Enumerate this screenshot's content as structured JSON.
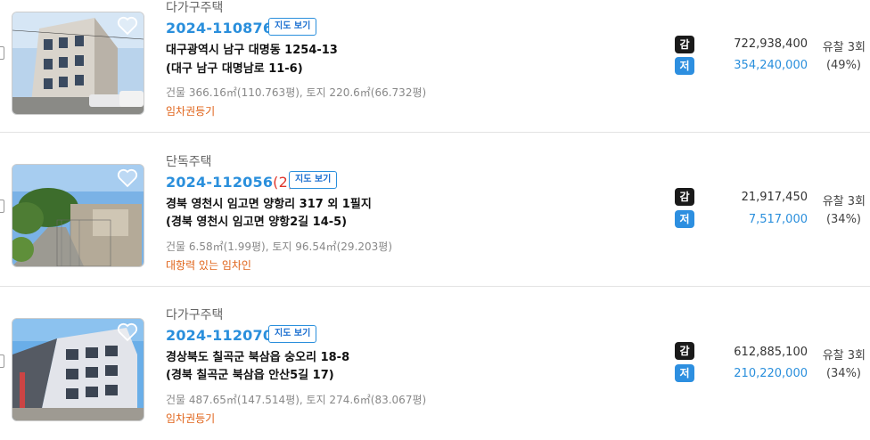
{
  "listings": [
    {
      "property_type": "다가구주택",
      "case_number": "2024-110876",
      "case_seq": "",
      "map_button": "지도 보기",
      "address": "대구광역시 남구 대명동 1254-13",
      "road_address": "(대구 남구 대명남로 11-6)",
      "area": "건물 366.16㎡(110.763평), 토지 220.6㎡(66.732평)",
      "note": "임차권등기",
      "appraisal_badge": "감",
      "minimum_badge": "저",
      "appraisal_price": "722,938,400",
      "minimum_price": "354,240,000",
      "fail_count": "유찰 3회",
      "percent": "(49%)"
    },
    {
      "property_type": "단독주택",
      "case_number": "2024-112056",
      "case_seq": "(2)",
      "map_button": "지도 보기",
      "address": "경북 영천시 임고면 양항리 317 외 1필지",
      "road_address": "(경북 영천시 임고면 양항2길 14-5)",
      "area": "건물 6.58㎡(1.99평), 토지 96.54㎡(29.203평)",
      "note": "대항력 있는 임차인",
      "appraisal_badge": "감",
      "minimum_badge": "저",
      "appraisal_price": "21,917,450",
      "minimum_price": "7,517,000",
      "fail_count": "유찰 3회",
      "percent": "(34%)"
    },
    {
      "property_type": "다가구주택",
      "case_number": "2024-112070",
      "case_seq": "",
      "map_button": "지도 보기",
      "address": "경상북도 칠곡군 북삼읍 숭오리 18-8",
      "road_address": "(경북 칠곡군 북삼읍 안산5길 17)",
      "area": "건물 487.65㎡(147.514평), 토지 274.6㎡(83.067평)",
      "note": "임차권등기",
      "appraisal_badge": "감",
      "minimum_badge": "저",
      "appraisal_price": "612,885,100",
      "minimum_price": "210,220,000",
      "fail_count": "유찰 3회",
      "percent": "(34%)"
    }
  ],
  "colors": {
    "case_number": "#2a8fdc",
    "minimum_price": "#2a8fdc",
    "note": "#e0641a",
    "case_seq": "#e0352b"
  },
  "icons": [
    "heart-icon",
    "checkbox"
  ]
}
